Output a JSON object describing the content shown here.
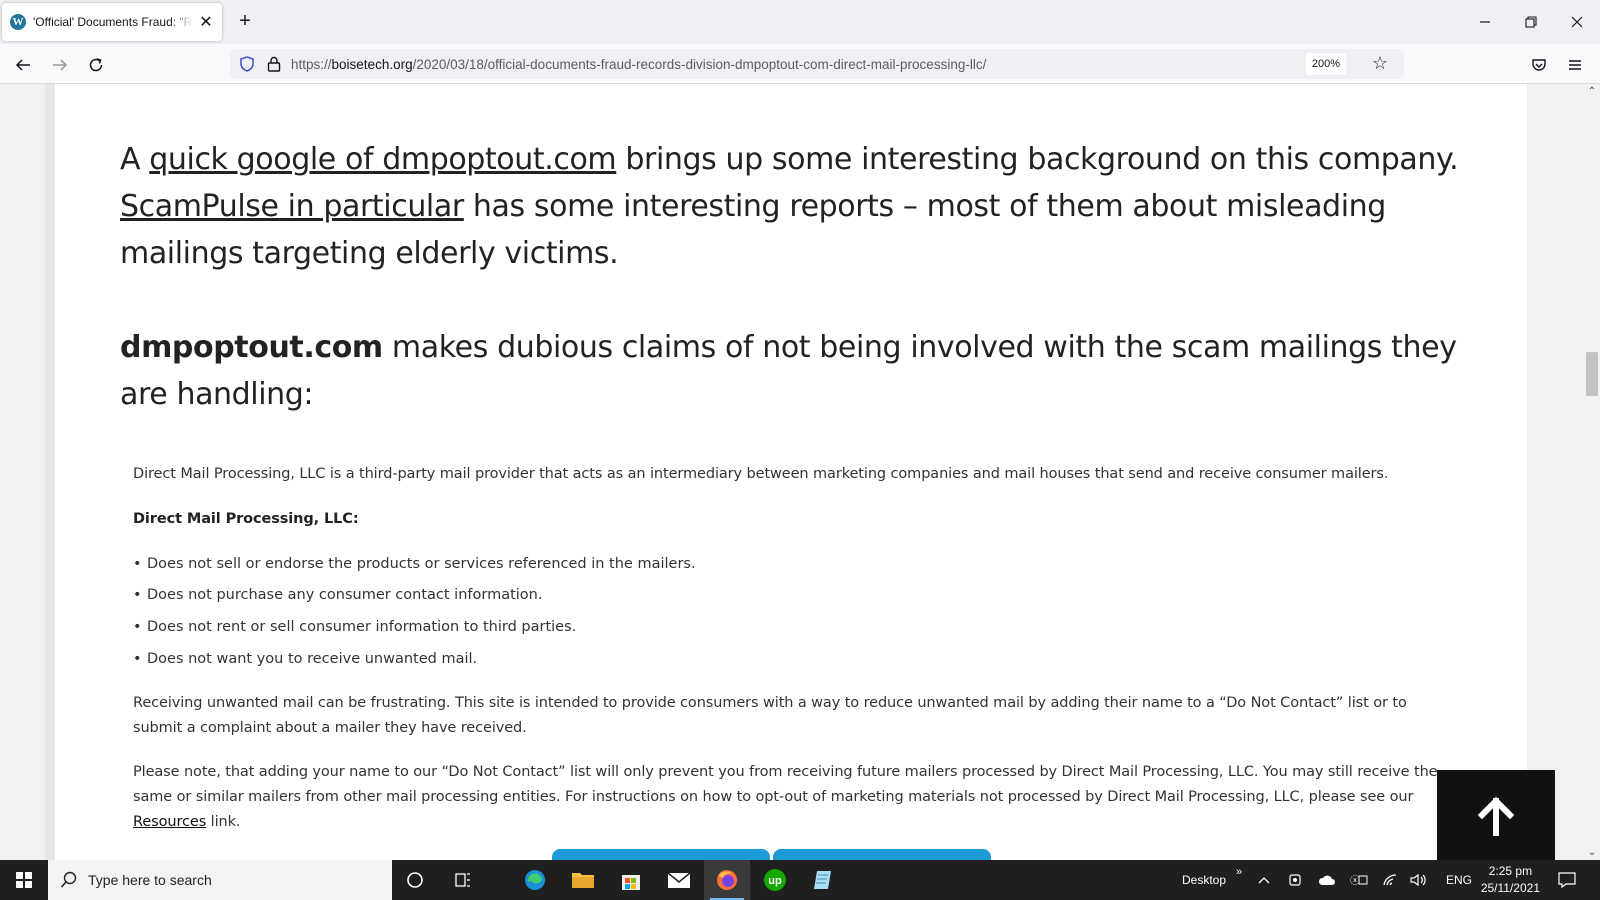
{
  "browser": {
    "tab_title": "'Official' Documents Fraud: \"Records Division\" dmpoptout.com",
    "tab_favicon": "W",
    "url_prefix": "https://",
    "url_host": "boisetech.org",
    "url_path": "/2020/03/18/official-documents-fraud-records-division-dmpoptout-com-direct-mail-processing-llc/",
    "zoom": "200%"
  },
  "article": {
    "para1_a": "A ",
    "para1_link": "quick google of dmpoptout.com",
    "para1_b": " brings up some interesting background on this company. ",
    "para1_link2": "ScamPulse in particular",
    "para1_c": " has some interesting reports – most of them about misleading mailings targeting elderly victims.",
    "para2_bold": "dmpoptout.com",
    "para2_rest": " makes dubious claims of not being involved with the scam mailings they are handling:",
    "quote_intro": "Direct Mail Processing, LLC is a third-party mail provider that acts as an intermediary between marketing companies and mail houses that send and receive consumer mailers.",
    "quote_heading": "Direct Mail Processing, LLC:",
    "bullets": [
      "Does not sell or endorse the products or services referenced in the mailers.",
      "Does not purchase any consumer contact information.",
      "Does not rent or sell consumer information to third parties.",
      "Does not want you to receive unwanted mail."
    ],
    "quote_p2": "Receiving unwanted mail can be frustrating. This site is intended to provide consumers with a way to reduce unwanted mail by adding their name to a “Do Not Contact” list or to submit a complaint about a mailer they have received.",
    "quote_p3_a": "Please note, that adding your name to our “Do Not Contact” list will only prevent you from receiving future mailers processed by Direct Mail Processing, LLC. You may still receive the same or similar mailers from other mail processing entities. For instructions on how to opt-out of marketing materials not processed by Direct Mail Processing, LLC, please see our ",
    "quote_p3_link": "Resources",
    "quote_p3_b": " link."
  },
  "taskbar": {
    "search_placeholder": "Type here to search",
    "desktop_label": "Desktop",
    "chevron": "»",
    "lang": "ENG",
    "time": "2:25 pm",
    "date": "25/11/2021"
  },
  "colors": {
    "accent_blue": "#1e9bd7",
    "taskbar": "#1f1f1f"
  }
}
